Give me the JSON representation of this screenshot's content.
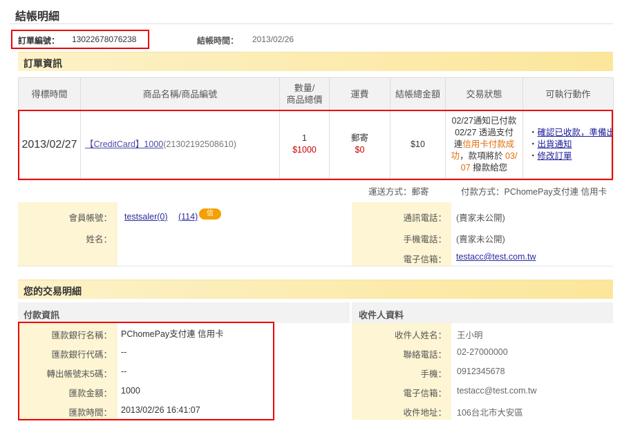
{
  "page_title": "結帳明細",
  "order": {
    "no_label": "訂單編號：",
    "no_value": "13022678076238",
    "settle_label": "結帳時間：",
    "settle_value": "2013/02/26"
  },
  "section_order_info": "訂單資訊",
  "table": {
    "headers": [
      "得標時間",
      "商品名稱/商品編號",
      "數量/\n商品總價",
      "運費",
      "結帳總金額",
      "交易狀態",
      "可執行動作"
    ],
    "row": {
      "date": "2013/02/27",
      "product_link": "【CreditCard】1000",
      "product_code": "(21302192508610)",
      "qty": "1",
      "price": "$1000",
      "ship_method": "郵寄",
      "ship_fee": "$0",
      "total": "$10",
      "status_1": "02/27通知已付款",
      "status_2": "02/27 透過支付",
      "status_3a": "連",
      "status_3b": "信用卡付款成",
      "status_4a": "功",
      "status_4b": "，款項將於",
      "status_4c": " 03/",
      "status_5a": "07",
      "status_5b": " 撥款給您",
      "actions": [
        "確認已收款，準備出貨",
        "出貨通知",
        "修改訂單"
      ]
    }
  },
  "ship_line": "運送方式：郵寄",
  "pay_line": "付款方式：PChomePay支付連 信用卡",
  "member": {
    "account_label": "會員帳號：",
    "account_value": "testsaler(0)",
    "rating": "(114)",
    "badge": "信",
    "name_label": "姓名：",
    "phone_label": "通訊電話：",
    "phone_value": "(賣家未公開)",
    "mobile_label": "手機電話：",
    "mobile_value": "(賣家未公開)",
    "email_label": "電子信箱：",
    "email_value": "testacc@test.com.tw"
  },
  "section_trade": "您的交易明細",
  "payment": {
    "title": "付款資訊",
    "rows": [
      {
        "label": "匯款銀行名稱：",
        "value": "PChomePay支付連 信用卡"
      },
      {
        "label": "匯款銀行代碼：",
        "value": "--"
      },
      {
        "label": "轉出帳號末5碼：",
        "value": "--"
      },
      {
        "label": "匯款金額：",
        "value": "1000"
      },
      {
        "label": "匯款時間：",
        "value": "2013/02/26 16:41:07"
      }
    ]
  },
  "receiver": {
    "title": "收件人資料",
    "rows": [
      {
        "label": "收件人姓名：",
        "value": "王小明"
      },
      {
        "label": "聯絡電話：",
        "value": "02-27000000"
      },
      {
        "label": "手機：",
        "value": "0912345678"
      },
      {
        "label": "電子信箱：",
        "value": "testacc@test.com.tw"
      },
      {
        "label": "收件地址：",
        "value": "106台北市大安區"
      }
    ]
  },
  "colors": {
    "highlight_border": "#e00000",
    "label_bg": "#fdf5d3",
    "section_bar": "#fbe69a",
    "red": "#cc0000",
    "orange": "#e36c09"
  }
}
